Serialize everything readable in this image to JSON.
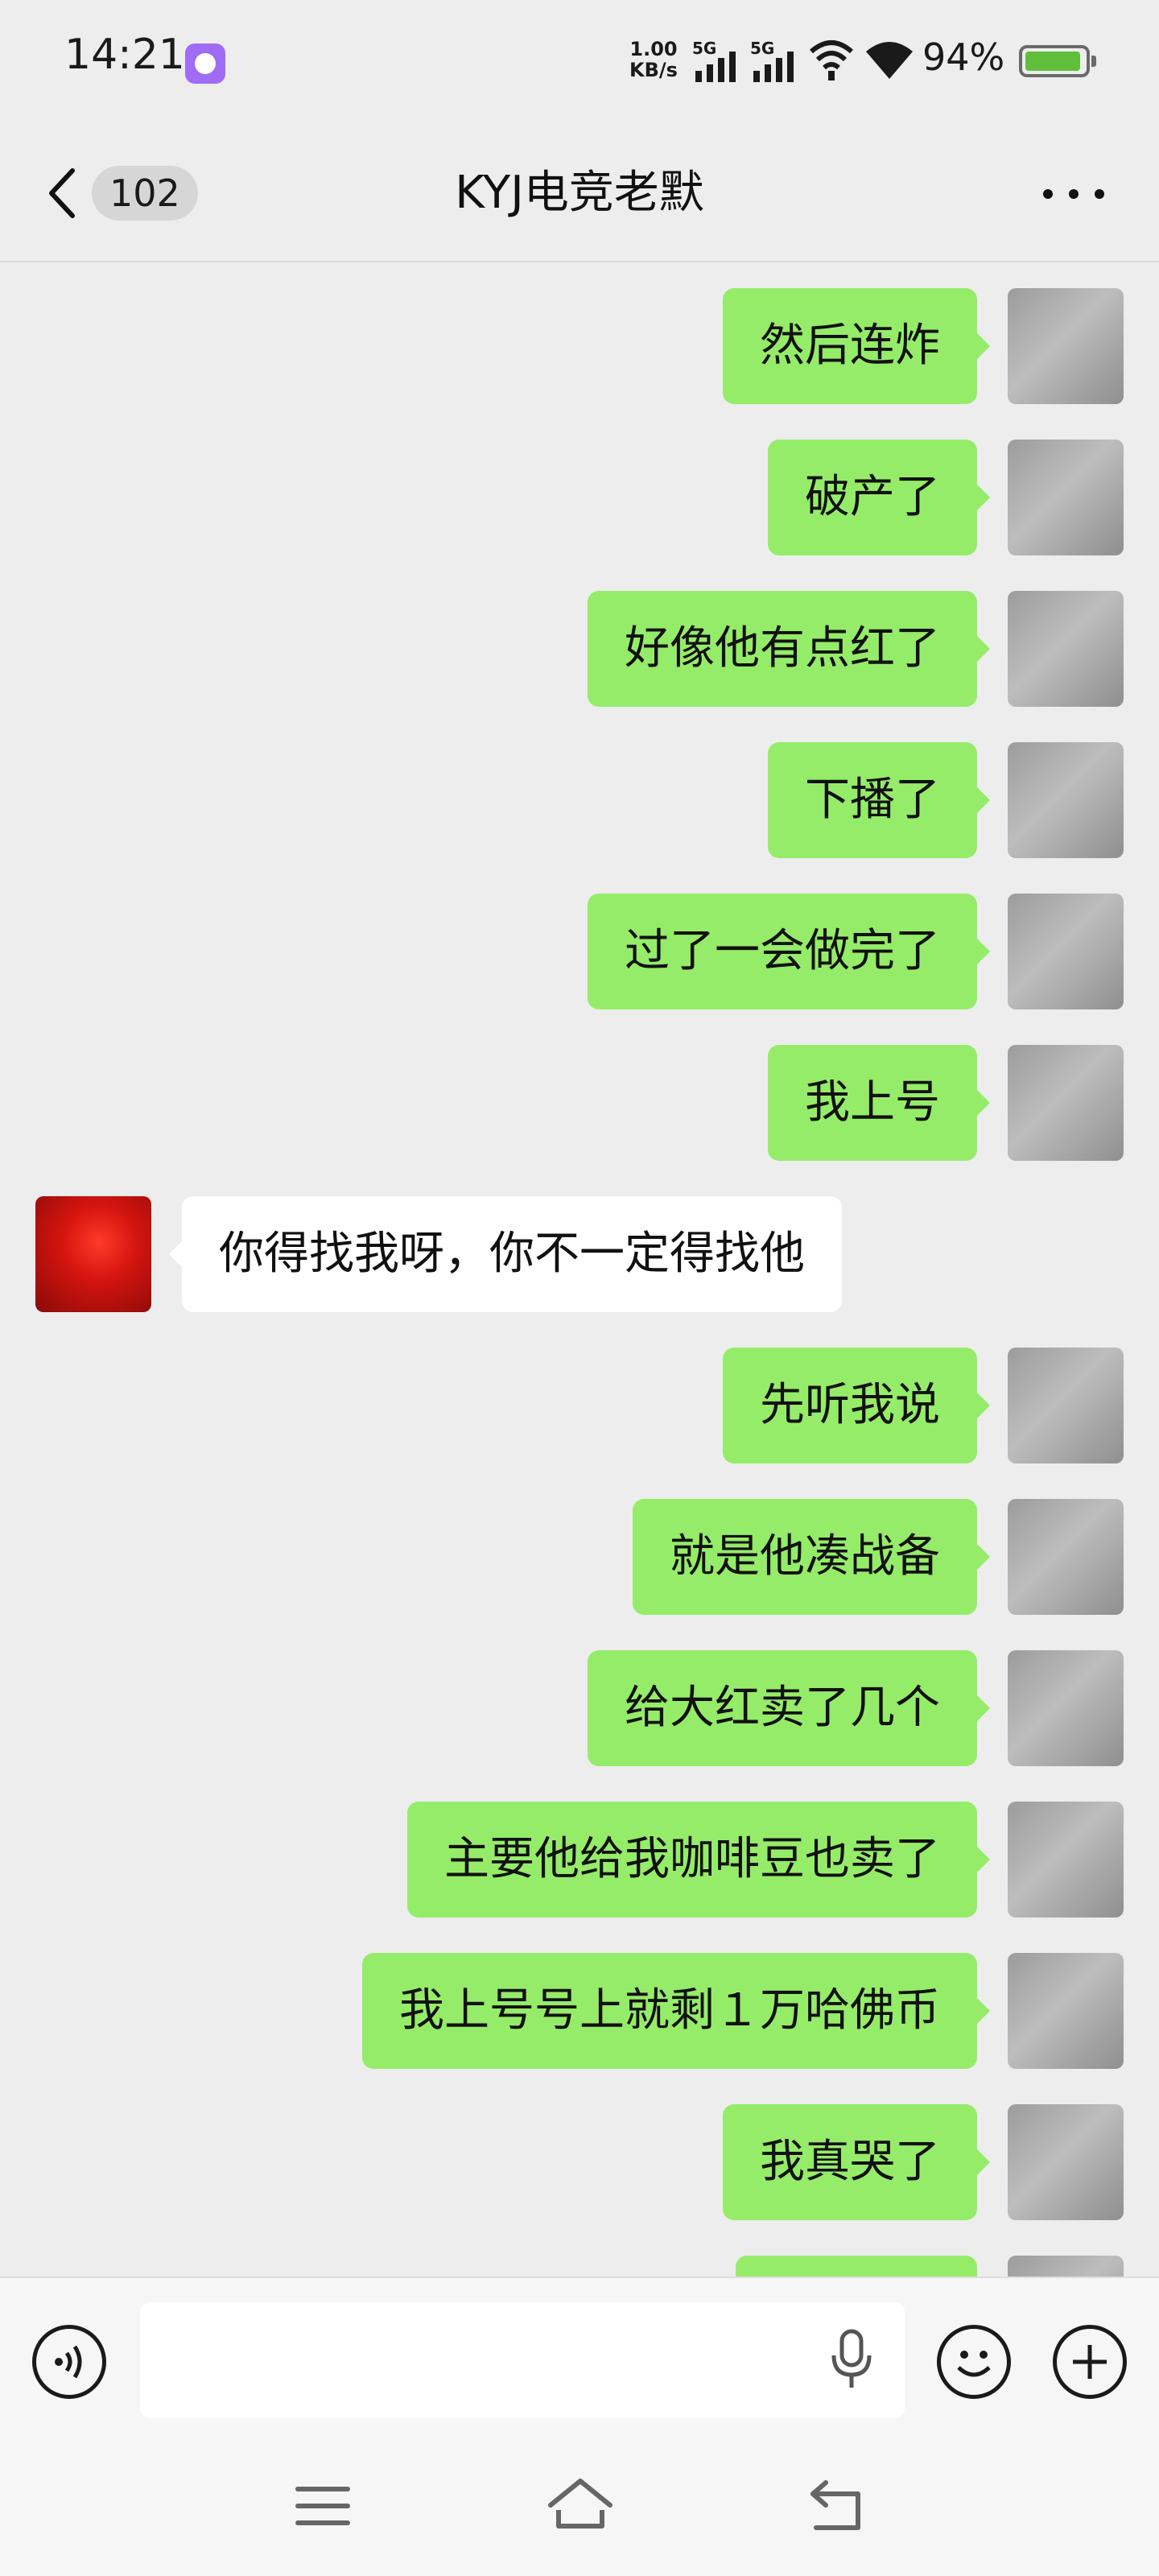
{
  "status_bar": {
    "time": "14:21",
    "net_speed_value": "1.00",
    "net_speed_unit": "KB/s",
    "signal_1_label": "5G",
    "signal_2_label": "5G",
    "battery_text": "94%",
    "battery_level": 0.94
  },
  "nav": {
    "unread_count": "102",
    "title": "KYJ电竞老默"
  },
  "messages": [
    {
      "side": "out",
      "text": "然后连炸"
    },
    {
      "side": "out",
      "text": "破产了"
    },
    {
      "side": "out",
      "text": "好像他有点红了"
    },
    {
      "side": "out",
      "text": "下播了"
    },
    {
      "side": "out",
      "text": "过了一会做完了"
    },
    {
      "side": "out",
      "text": "我上号"
    },
    {
      "side": "in",
      "text": "你得找我呀，你不一定得找他"
    },
    {
      "side": "out",
      "text": "先听我说"
    },
    {
      "side": "out",
      "text": "就是他凑战备"
    },
    {
      "side": "out",
      "text": "给大红卖了几个"
    },
    {
      "side": "out",
      "text": "主要他给我咖啡豆也卖了"
    },
    {
      "side": "out",
      "text": "我上号号上就剩１万哈佛币"
    },
    {
      "side": "out",
      "text": "我真哭了"
    },
    {
      "side": "out",
      "text": ""
    }
  ],
  "input": {
    "value": "",
    "placeholder": ""
  },
  "colors": {
    "outgoing_bubble": "#95ec69",
    "incoming_bubble": "#ffffff",
    "background": "#ededed",
    "battery_fill": "#5fbf3b"
  },
  "icons": {
    "back": "chevron-left-icon",
    "more": "ellipsis-icon",
    "voice": "voice-wave-icon",
    "mic": "microphone-icon",
    "emoji": "smiley-icon",
    "plus": "plus-icon",
    "menu": "menu-icon",
    "home": "home-icon",
    "return": "return-icon"
  }
}
